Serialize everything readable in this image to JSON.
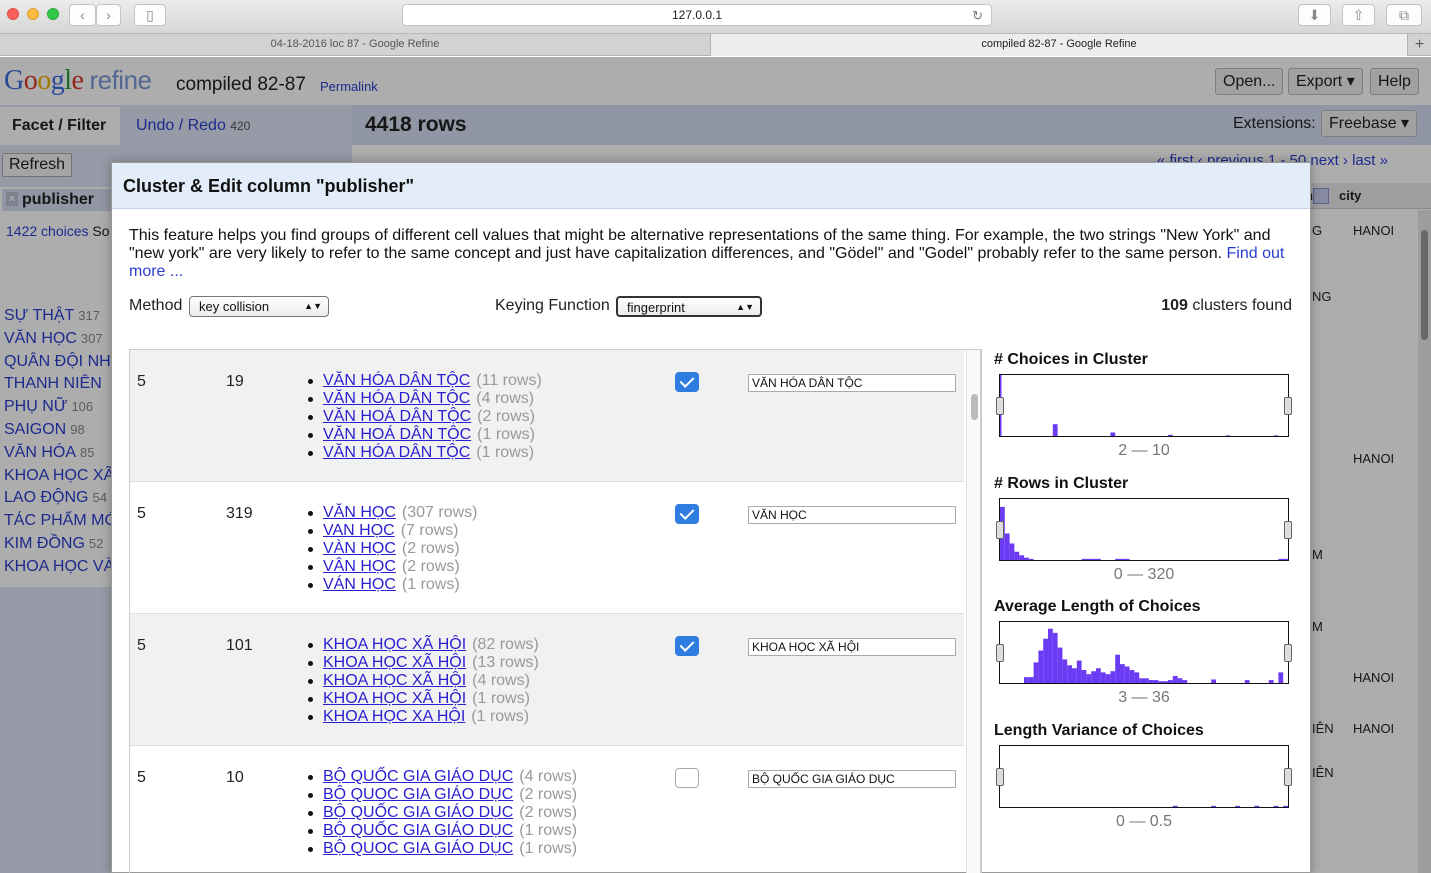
{
  "browser": {
    "url": "127.0.0.1",
    "tabs": [
      {
        "label": "04-18-2016 loc 87 - Google Refine",
        "active": false
      },
      {
        "label": "compiled 82-87 - Google Refine",
        "active": true
      }
    ],
    "new_tab": "+"
  },
  "app": {
    "logo_google": [
      "G",
      "o",
      "o",
      "g",
      "l",
      "e"
    ],
    "logo_refine": "refine",
    "project_name": "compiled 82-87",
    "permalink": "Permalink",
    "open_btn": "Open...",
    "export_btn": "Export ▾",
    "help_btn": "Help"
  },
  "left": {
    "facet_tab": "Facet / Filter",
    "undo_tab": "Undo / Redo",
    "undo_count": "420",
    "refresh": "Refresh",
    "facet_title": "publisher",
    "facet_close": "×",
    "facet_choices": "1422 choices",
    "facet_sort_hint": "So",
    "facet_items": [
      {
        "label": "SỰ THẬT",
        "count": "317"
      },
      {
        "label": "VĂN HỌC",
        "count": "307"
      },
      {
        "label": "QUÂN ĐỘI NH",
        "count": ""
      },
      {
        "label": "THANH NIÊN",
        "count": ""
      },
      {
        "label": "PHỤ NỮ",
        "count": "106"
      },
      {
        "label": "SAIGON",
        "count": "98"
      },
      {
        "label": "VĂN HÓA",
        "count": "85"
      },
      {
        "label": "KHOA HỌC XÃ",
        "count": ""
      },
      {
        "label": "LAO ĐỘNG",
        "count": "54"
      },
      {
        "label": "TÁC PHẨM MỚ",
        "count": ""
      },
      {
        "label": "KIM ĐỒNG",
        "count": "52"
      },
      {
        "label": "KHOA HỌC VÀ",
        "count": ""
      }
    ]
  },
  "right": {
    "rows_count": "4418 rows",
    "extensions_label": "Extensions:",
    "freebase_btn": "Freebase ▾",
    "pager": "« first ‹ previous  1 - 50  next ›  last »",
    "col_partial": "her",
    "col_city": "city",
    "city_cells": [
      "HANOI",
      "",
      "",
      "HANOI",
      "",
      "",
      "",
      "HANOI",
      "HANOI"
    ],
    "publisher_partial_cells": [
      "G",
      "NG",
      "M",
      "M",
      "IÊN",
      "IÊN"
    ]
  },
  "modal": {
    "title": "Cluster & Edit column \"publisher\"",
    "description": "This feature helps you find groups of different cell values that might be alternative representations of the same thing. For example, the two strings \"New York\" and \"new york\" are very likely to refer to the same concept and just have capitalization differences, and \"Gödel\" and \"Godel\" probably refer to the same person.",
    "find_out_more": "Find out more ...",
    "method_label": "Method",
    "method_value": "key collision",
    "keying_label": "Keying Function",
    "keying_value": "fingerprint",
    "clusters_count": "109",
    "clusters_suffix": "clusters found",
    "clusters": [
      {
        "size": "5",
        "rows": "19",
        "merge": true,
        "new_value": "VĂN HÓA DÂN TỘC",
        "values": [
          {
            "v": "VĂN HÓA DÂN TỘC",
            "c": "(11 rows)"
          },
          {
            "v": "VĂN HÓA DÂN TỘC",
            "c": "(4 rows)"
          },
          {
            "v": "VĂN HOÁ DÂN TỘC",
            "c": "(2 rows)"
          },
          {
            "v": "VĂN HOÁ DÂN TỘC",
            "c": "(1 rows)"
          },
          {
            "v": "VĂN HÓA DÂN TỘC",
            "c": "(1 rows)"
          }
        ]
      },
      {
        "size": "5",
        "rows": "319",
        "merge": true,
        "new_value": "VĂN HỌC",
        "values": [
          {
            "v": "VĂN HỌC",
            "c": "(307 rows)"
          },
          {
            "v": "VAN HỌC",
            "c": "(7 rows)"
          },
          {
            "v": "VÀN HỌC",
            "c": "(2 rows)"
          },
          {
            "v": "VÂN HỌC",
            "c": "(2 rows)"
          },
          {
            "v": "VÁN HỌC",
            "c": "(1 rows)"
          }
        ]
      },
      {
        "size": "5",
        "rows": "101",
        "merge": true,
        "new_value": "KHOA HỌC XÃ HỘI",
        "values": [
          {
            "v": "KHOA HỌC XÃ HỘI",
            "c": "(82 rows)"
          },
          {
            "v": "KHOA HỌC XÃ HỘI",
            "c": "(13 rows)"
          },
          {
            "v": "KHOA HỌC XÃ HỘI",
            "c": "(4 rows)"
          },
          {
            "v": "KHOA HỌC XÃ HỘI",
            "c": "(1 rows)"
          },
          {
            "v": "KHOA HỌC XA HỘI",
            "c": "(1 rows)"
          }
        ]
      },
      {
        "size": "5",
        "rows": "10",
        "merge": false,
        "new_value": "BỘ QUỐC GIA GIÁO DỤC",
        "values": [
          {
            "v": "BỘ QUỐC GIA GIÁO DỤC",
            "c": "(4 rows)"
          },
          {
            "v": "BỘ QUOC GIA GIÁO DỤC",
            "c": "(2 rows)"
          },
          {
            "v": "BỘ QUỐC GIA GIÁO DỤC",
            "c": "(2 rows)"
          },
          {
            "v": "BỘ QUỐC GIA GIÁO DỤC",
            "c": "(1 rows)"
          },
          {
            "v": "BỘ QUOC GIA GIÁO DỤC",
            "c": "(1 rows)"
          }
        ]
      }
    ],
    "histograms": [
      {
        "title": "# Choices in Cluster",
        "range": "2 — 10",
        "bars": [
          0,
          0,
          0,
          0,
          0,
          0,
          0,
          0,
          0,
          0,
          0,
          20,
          0,
          0,
          0,
          0,
          0,
          0,
          0,
          0,
          0,
          0,
          0,
          6,
          0,
          0,
          0,
          0,
          0,
          0,
          0,
          0,
          0,
          0,
          0,
          2,
          0,
          0,
          0,
          0,
          0,
          0,
          0,
          0,
          0,
          0,
          0,
          1,
          0,
          0,
          0,
          0,
          0,
          0,
          0,
          0,
          0,
          1,
          0,
          0
        ],
        "first_bar": 100
      },
      {
        "title": "# Rows in Cluster",
        "range": "0 — 320",
        "bars": [
          90,
          45,
          28,
          14,
          8,
          4,
          2,
          0,
          0,
          0,
          0,
          0,
          0,
          0,
          0,
          0,
          0,
          2,
          2,
          2,
          2,
          0,
          0,
          0,
          2,
          2,
          2,
          0,
          0,
          0,
          0,
          0,
          0,
          0,
          0,
          0,
          0,
          0,
          0,
          0,
          0,
          0,
          0,
          0,
          0,
          0,
          0,
          0,
          0,
          0,
          0,
          0,
          0,
          0,
          0,
          0,
          0,
          0,
          2,
          2
        ]
      },
      {
        "title": "Average Length of Choices",
        "range": "3 — 36",
        "bars": [
          0,
          0,
          0,
          0,
          0,
          10,
          10,
          35,
          55,
          75,
          92,
          85,
          60,
          40,
          30,
          25,
          38,
          22,
          15,
          20,
          25,
          18,
          15,
          20,
          48,
          32,
          28,
          22,
          18,
          8,
          8,
          5,
          5,
          3,
          3,
          5,
          12,
          8,
          5,
          0,
          0,
          0,
          0,
          0,
          6,
          0,
          0,
          0,
          0,
          0,
          0,
          5,
          0,
          0,
          0,
          0,
          5,
          0,
          18,
          0
        ]
      },
      {
        "title": "Length Variance of Choices",
        "range": "0 — 0.5",
        "bars": [
          0,
          0,
          0,
          0,
          0,
          0,
          0,
          0,
          0,
          0,
          0,
          0,
          0,
          0,
          0,
          0,
          0,
          0,
          0,
          0,
          0,
          0,
          0,
          0,
          0,
          0,
          0,
          0,
          0,
          0,
          0,
          0,
          0,
          0,
          0,
          0,
          2,
          0,
          0,
          0,
          0,
          0,
          0,
          0,
          2,
          0,
          0,
          0,
          0,
          2,
          0,
          0,
          0,
          2,
          0,
          0,
          0,
          2,
          0,
          2
        ]
      }
    ],
    "histogram_color": "#6c3cf4"
  }
}
